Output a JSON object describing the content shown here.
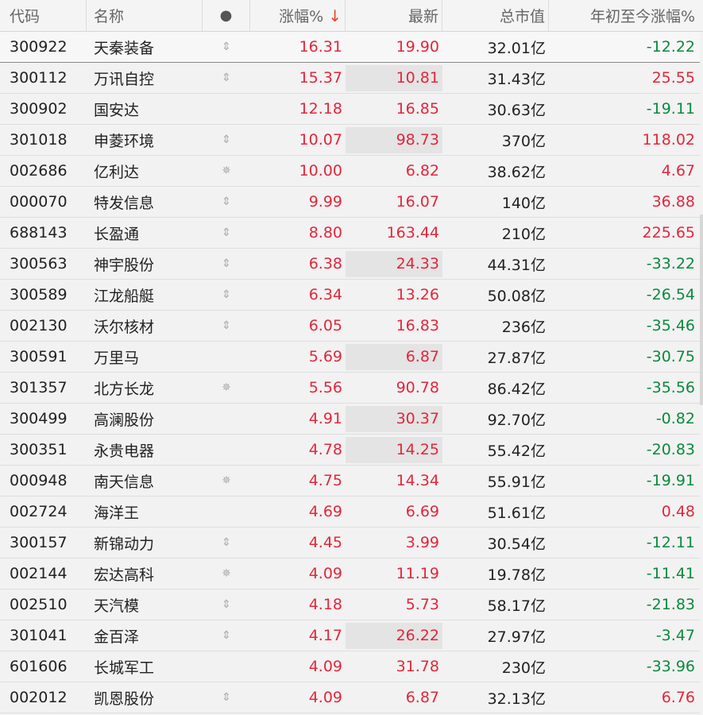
{
  "header": {
    "code": "代码",
    "name": "名称",
    "flag": "●",
    "change": "涨幅%",
    "sort_icon": "↓",
    "last": "最新",
    "market_cap": "总市值",
    "ytd": "年初至今涨幅%"
  },
  "rows": [
    {
      "code": "300922",
      "name": "天秦装备",
      "flag": "updown",
      "change": "16.31",
      "last": "19.90",
      "cap": "32.01亿",
      "ytd": "-12.22",
      "ytd_color": "green",
      "hl": false
    },
    {
      "code": "300112",
      "name": "万讯自控",
      "flag": "updown",
      "change": "15.37",
      "last": "10.81",
      "cap": "31.43亿",
      "ytd": "25.55",
      "ytd_color": "red",
      "hl": true
    },
    {
      "code": "300902",
      "name": "国安达",
      "flag": "",
      "change": "12.18",
      "last": "16.85",
      "cap": "30.63亿",
      "ytd": "-19.11",
      "ytd_color": "green",
      "hl": false
    },
    {
      "code": "301018",
      "name": "申菱环境",
      "flag": "updown",
      "change": "10.07",
      "last": "98.73",
      "cap": "370亿",
      "ytd": "118.02",
      "ytd_color": "red",
      "hl": true
    },
    {
      "code": "002686",
      "name": "亿利达",
      "flag": "spark",
      "change": "10.00",
      "last": "6.82",
      "cap": "38.62亿",
      "ytd": "4.67",
      "ytd_color": "red",
      "hl": false
    },
    {
      "code": "000070",
      "name": "特发信息",
      "flag": "updown",
      "change": "9.99",
      "last": "16.07",
      "cap": "140亿",
      "ytd": "36.88",
      "ytd_color": "red",
      "hl": false
    },
    {
      "code": "688143",
      "name": "长盈通",
      "flag": "updown",
      "change": "8.80",
      "last": "163.44",
      "cap": "210亿",
      "ytd": "225.65",
      "ytd_color": "red",
      "hl": false
    },
    {
      "code": "300563",
      "name": "神宇股份",
      "flag": "updown",
      "change": "6.38",
      "last": "24.33",
      "cap": "44.31亿",
      "ytd": "-33.22",
      "ytd_color": "green",
      "hl": true
    },
    {
      "code": "300589",
      "name": "江龙船艇",
      "flag": "updown",
      "change": "6.34",
      "last": "13.26",
      "cap": "50.08亿",
      "ytd": "-26.54",
      "ytd_color": "green",
      "hl": false
    },
    {
      "code": "002130",
      "name": "沃尔核材",
      "flag": "updown",
      "change": "6.05",
      "last": "16.83",
      "cap": "236亿",
      "ytd": "-35.46",
      "ytd_color": "green",
      "hl": false
    },
    {
      "code": "300591",
      "name": "万里马",
      "flag": "",
      "change": "5.69",
      "last": "6.87",
      "cap": "27.87亿",
      "ytd": "-30.75",
      "ytd_color": "green",
      "hl": true
    },
    {
      "code": "301357",
      "name": "北方长龙",
      "flag": "spark",
      "change": "5.56",
      "last": "90.78",
      "cap": "86.42亿",
      "ytd": "-35.56",
      "ytd_color": "green",
      "hl": false
    },
    {
      "code": "300499",
      "name": "高澜股份",
      "flag": "",
      "change": "4.91",
      "last": "30.37",
      "cap": "92.70亿",
      "ytd": "-0.82",
      "ytd_color": "green",
      "hl": true
    },
    {
      "code": "300351",
      "name": "永贵电器",
      "flag": "",
      "change": "4.78",
      "last": "14.25",
      "cap": "55.42亿",
      "ytd": "-20.83",
      "ytd_color": "green",
      "hl": true
    },
    {
      "code": "000948",
      "name": "南天信息",
      "flag": "spark",
      "change": "4.75",
      "last": "14.34",
      "cap": "55.91亿",
      "ytd": "-19.91",
      "ytd_color": "green",
      "hl": false
    },
    {
      "code": "002724",
      "name": "海洋王",
      "flag": "",
      "change": "4.69",
      "last": "6.69",
      "cap": "51.61亿",
      "ytd": "0.48",
      "ytd_color": "red",
      "hl": false
    },
    {
      "code": "300157",
      "name": "新锦动力",
      "flag": "updown",
      "change": "4.45",
      "last": "3.99",
      "cap": "30.54亿",
      "ytd": "-12.11",
      "ytd_color": "green",
      "hl": false
    },
    {
      "code": "002144",
      "name": "宏达高科",
      "flag": "spark",
      "change": "4.09",
      "last": "11.19",
      "cap": "19.78亿",
      "ytd": "-11.41",
      "ytd_color": "green",
      "hl": false
    },
    {
      "code": "002510",
      "name": "天汽模",
      "flag": "updown",
      "change": "4.18",
      "last": "5.73",
      "cap": "58.17亿",
      "ytd": "-21.83",
      "ytd_color": "green",
      "hl": false
    },
    {
      "code": "301041",
      "name": "金百泽",
      "flag": "updown",
      "change": "4.17",
      "last": "26.22",
      "cap": "27.97亿",
      "ytd": "-3.47",
      "ytd_color": "green",
      "hl": true
    },
    {
      "code": "601606",
      "name": "长城军工",
      "flag": "",
      "change": "4.09",
      "last": "31.78",
      "cap": "230亿",
      "ytd": "-33.96",
      "ytd_color": "green",
      "hl": false
    },
    {
      "code": "002012",
      "name": "凯恩股份",
      "flag": "updown",
      "change": "4.09",
      "last": "6.87",
      "cap": "32.13亿",
      "ytd": "6.76",
      "ytd_color": "red",
      "hl": false
    }
  ],
  "colors": {
    "up": "#e3263b",
    "down": "#0b8a3d",
    "highlight": "#e4e4e4",
    "background": "#f2f2f2"
  }
}
